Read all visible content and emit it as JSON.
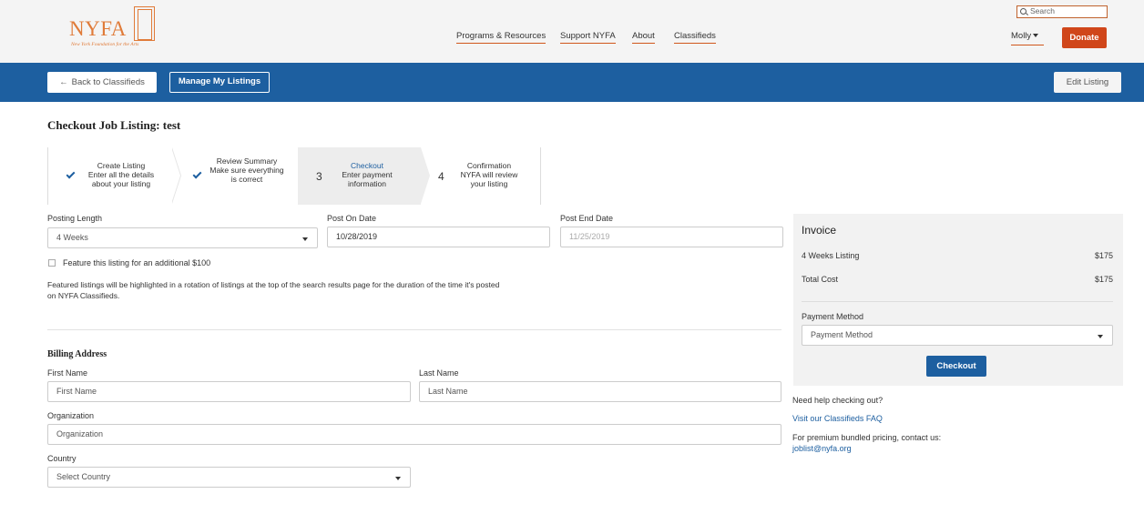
{
  "header": {
    "logo_text": "NYFA",
    "logo_subtitle": "New York Foundation for the Arts",
    "nav": [
      "Programs & Resources",
      "Support NYFA",
      "About",
      "Classifieds"
    ],
    "search_placeholder": "Search",
    "user_name": "Molly",
    "donate_label": "Donate"
  },
  "toolbar": {
    "back_label": "Back to Classifieds",
    "manage_label": "Manage My Listings",
    "edit_label": "Edit Listing"
  },
  "page_title": "Checkout Job Listing: test",
  "steps": [
    {
      "marker": "check",
      "title": "Create Listing",
      "desc": "Enter all the details about your listing"
    },
    {
      "marker": "check",
      "title": "Review Summary",
      "desc": "Make sure everything is correct"
    },
    {
      "marker": "3",
      "title": "Checkout",
      "desc": "Enter payment information"
    },
    {
      "marker": "4",
      "title": "Confirmation",
      "desc": "NYFA will review your listing"
    }
  ],
  "posting": {
    "length_label": "Posting Length",
    "length_value": "4 Weeks",
    "on_date_label": "Post On Date",
    "on_date_value": "10/28/2019",
    "end_date_label": "Post End Date",
    "end_date_value": "11/25/2019",
    "feature_label": "Feature this listing for an additional $100",
    "feature_note": "Featured listings will be highlighted in a rotation of listings at the top of the search results page for the duration of the time it's posted on NYFA Classifieds."
  },
  "billing": {
    "title": "Billing Address",
    "first_name_label": "First Name",
    "first_name_placeholder": "First Name",
    "last_name_label": "Last Name",
    "last_name_placeholder": "Last Name",
    "org_label": "Organization",
    "org_placeholder": "Organization",
    "country_label": "Country",
    "country_value": "Select Country"
  },
  "invoice": {
    "title": "Invoice",
    "line_label": "4 Weeks Listing",
    "line_amount": "$175",
    "total_label": "Total Cost",
    "total_amount": "$175",
    "payment_label": "Payment Method",
    "payment_value": "Payment Method",
    "checkout_label": "Checkout"
  },
  "help": {
    "question": "Need help checking out?",
    "faq_link": "Visit our Classifieds FAQ",
    "pricing_text": "For premium bundled pricing, contact us:",
    "email": "joblist@nyfa.org"
  },
  "colors": {
    "brand_orange": "#e07b39",
    "accent_blue": "#1d5fa0",
    "donate_red": "#d0461a"
  }
}
